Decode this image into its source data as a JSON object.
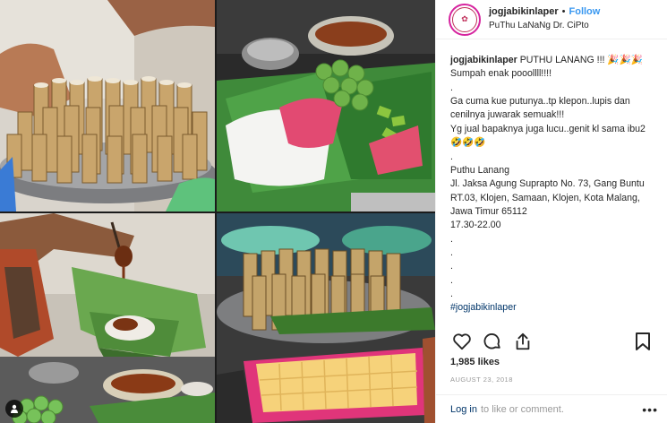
{
  "post": {
    "username": "jogjabikinlaper",
    "follow_label": "Follow",
    "separator": "•",
    "location": "PuThu LaNaNg Dr. CiPto",
    "caption": {
      "username": "jogjabikinlaper",
      "body": " PUTHU LANANG !!! 🎉🎉🎉\nSumpah enak pooollll!!!!\n.\nGa cuma kue putunya..tp klepon..lupis dan cenilnya juwarak semuak!!!\nYg jual bapaknya juga lucu..genit kl sama ibu2 🤣🤣🤣\n.\nPuthu Lanang\nJl. Jaksa Agung Suprapto No. 73, Gang Buntu RT.03, Klojen, Samaan, Klojen, Kota Malang, Jawa Timur 65112\n17.30-22.00\n.\n.\n.\n.\n.",
      "hashtag": "#jogjabikinlaper"
    },
    "likes": "1,985 likes",
    "date": "AUGUST 23, 2018"
  },
  "icons": {
    "like": "heart-icon",
    "comment": "comment-icon",
    "share": "share-icon",
    "save": "bookmark-icon",
    "user_tag": "user-tag-icon",
    "more": "more-options-icon"
  },
  "footer": {
    "login_link": "Log in",
    "login_rest": "to like or comment.",
    "more": "•••"
  },
  "colors": {
    "link_blue": "#3897f0",
    "hashtag": "#003569",
    "muted": "#999999",
    "text": "#262626"
  }
}
